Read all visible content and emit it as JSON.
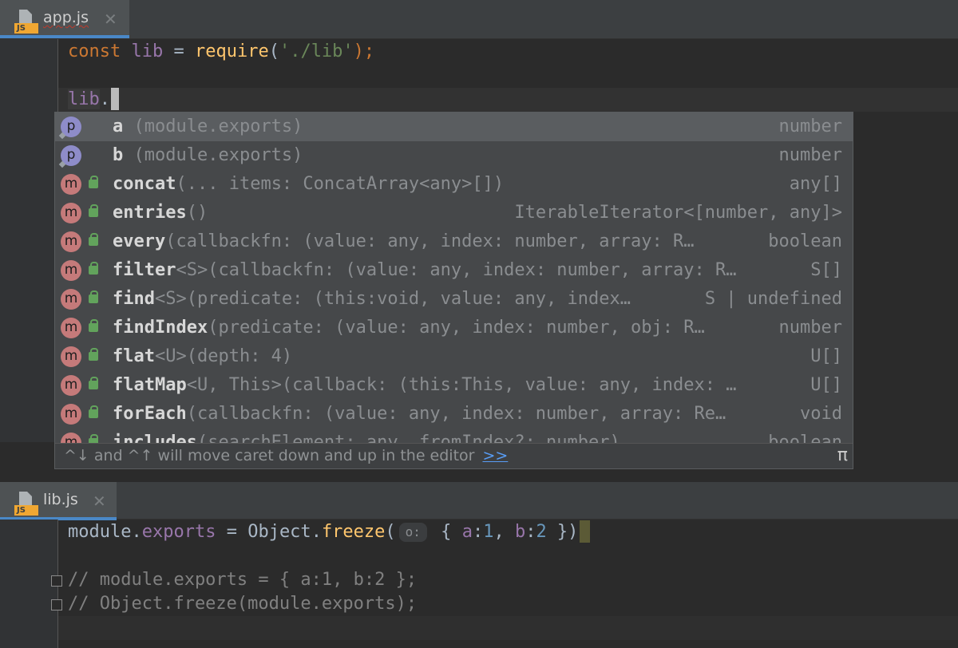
{
  "editor_top": {
    "tab": {
      "filename": "app.js",
      "close": "✕",
      "badge": "JS"
    },
    "lines": {
      "l1": {
        "t1": "const",
        "t2": " ",
        "t3": "lib",
        "t4": " = ",
        "t5": "require",
        "t6": "(",
        "t7": "'./lib'",
        "t8": ");"
      },
      "l3": {
        "t1": "lib",
        "t2": "."
      }
    }
  },
  "completion": {
    "items": [
      {
        "icon": "p",
        "name": "a",
        "sig": " (module.exports)",
        "type": "number"
      },
      {
        "icon": "p",
        "name": "b",
        "sig": " (module.exports)",
        "type": "number"
      },
      {
        "icon": "m",
        "name": "concat",
        "sig": "(... items: ConcatArray<any>[])",
        "type": "any[]"
      },
      {
        "icon": "m",
        "name": "entries",
        "sig": "()",
        "type": "IterableIterator<[number, any]>"
      },
      {
        "icon": "m",
        "name": "every",
        "sig": "(callbackfn: (value: any, index: number, array: R…",
        "type": "boolean"
      },
      {
        "icon": "m",
        "name": "filter",
        "sig": "<S>(callbackfn: (value: any, index: number, array: R…",
        "type": "S[]"
      },
      {
        "icon": "m",
        "name": "find",
        "sig": "<S>(predicate: (this:void, value: any, index…",
        "type": "S | undefined"
      },
      {
        "icon": "m",
        "name": "findIndex",
        "sig": "(predicate: (value: any, index: number, obj: R…",
        "type": "number"
      },
      {
        "icon": "m",
        "name": "flat",
        "sig": "<U>(depth: 4)",
        "type": "U[]"
      },
      {
        "icon": "m",
        "name": "flatMap",
        "sig": "<U, This>(callback: (this:This, value: any, index: …",
        "type": "U[]"
      },
      {
        "icon": "m",
        "name": "forEach",
        "sig": "(callbackfn: (value: any, index: number, array: Re…",
        "type": "void"
      },
      {
        "icon": "m",
        "name": "includes",
        "sig": "(searchElement: any, fromIndex?: number)",
        "type": "boolean"
      }
    ],
    "hint_text": "^↓ and ^↑ will move caret down and up in the editor",
    "hint_more": ">>",
    "pi": "π"
  },
  "editor_bottom": {
    "tab": {
      "filename": "lib.js",
      "close": "✕",
      "badge": "JS"
    },
    "lines": {
      "l1": {
        "t1": "module",
        "t2": ".",
        "t3": "exports",
        "t4": " = ",
        "t5": "Object",
        "t6": ".",
        "t7": "freeze",
        "t8": "(",
        "hint": "o:",
        "t9": " { ",
        "t10": "a",
        "t11": ":",
        "t12": "1",
        "t13": ", ",
        "t14": "b",
        "t15": ":",
        "t16": "2",
        "t17": " })"
      },
      "l3": "// module.exports = { a:1, b:2 };",
      "l4": "// Object.freeze(module.exports);"
    }
  }
}
